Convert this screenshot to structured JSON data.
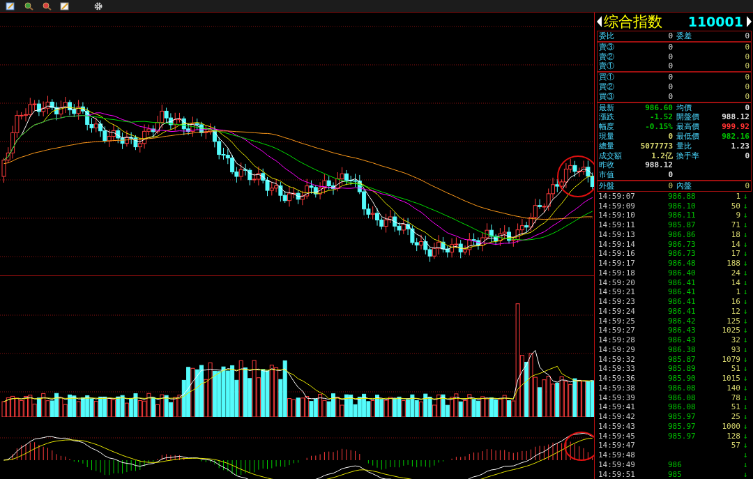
{
  "quote": {
    "name": "综合指数",
    "code": "110001"
  },
  "order_ratio": [
    {
      "label": "委比",
      "value": "0"
    },
    {
      "label": "委差",
      "value": "0"
    }
  ],
  "sell_levels": [
    {
      "label": "賣③",
      "price": "0",
      "volume": "0"
    },
    {
      "label": "賣②",
      "price": "0",
      "volume": "0"
    },
    {
      "label": "賣①",
      "price": "0",
      "volume": "0"
    }
  ],
  "buy_levels": [
    {
      "label": "買①",
      "price": "0",
      "volume": "0"
    },
    {
      "label": "買②",
      "price": "0",
      "volume": "0"
    },
    {
      "label": "買③",
      "price": "0",
      "volume": "0"
    }
  ],
  "stats": [
    {
      "left": {
        "label": "最新",
        "value": "986.60",
        "color": "#00c000"
      },
      "right": {
        "label": "均價",
        "value": "0",
        "color": "#e0e0e0"
      }
    },
    {
      "left": {
        "label": "漲跌",
        "value": "-1.52",
        "color": "#00c000"
      },
      "right": {
        "label": "開盤價",
        "value": "988.12",
        "color": "#e0e0e0"
      }
    },
    {
      "left": {
        "label": "幅度",
        "value": "-0.15%",
        "color": "#00c000"
      },
      "right": {
        "label": "最高價",
        "value": "999.92",
        "color": "#ff3232"
      }
    },
    {
      "left": {
        "label": "現量",
        "value": "0",
        "color": "#d8d870"
      },
      "right": {
        "label": "最低價",
        "value": "982.16",
        "color": "#00c000"
      }
    },
    {
      "left": {
        "label": "總量",
        "value": "5077773",
        "color": "#d8d870"
      },
      "right": {
        "label": "量比",
        "value": "1.23",
        "color": "#e0e0e0"
      }
    },
    {
      "left": {
        "label": "成交額",
        "value": "1.2亿",
        "color": "#d8d870"
      },
      "right": {
        "label": "換手率",
        "value": "0",
        "color": "#e0e0e0"
      }
    },
    {
      "left": {
        "label": "昨收",
        "value": "988.12",
        "color": "#e0e0e0"
      }
    },
    {
      "left": {
        "label": "市值",
        "value": "0",
        "color": "#e0e0e0"
      }
    }
  ],
  "volume_split": [
    {
      "label": "外盤",
      "value": "0"
    },
    {
      "label": "內盤",
      "value": "0"
    }
  ],
  "ticks": [
    {
      "time": "14:59:07",
      "price": "986.88",
      "volume": "1",
      "arrow": "↓"
    },
    {
      "time": "14:59:09",
      "price": "986.10",
      "volume": "50",
      "arrow": "↓"
    },
    {
      "time": "14:59:10",
      "price": "986.11",
      "volume": "9",
      "arrow": "↓"
    },
    {
      "time": "14:59:11",
      "price": "985.87",
      "volume": "71",
      "arrow": "↓"
    },
    {
      "time": "14:59:13",
      "price": "986.86",
      "volume": "18",
      "arrow": "↓"
    },
    {
      "time": "14:59:14",
      "price": "986.73",
      "volume": "14",
      "arrow": "↓"
    },
    {
      "time": "14:59:16",
      "price": "986.73",
      "volume": "17",
      "arrow": "↓"
    },
    {
      "time": "14:59:17",
      "price": "986.48",
      "volume": "188",
      "arrow": "↓"
    },
    {
      "time": "14:59:18",
      "price": "986.40",
      "volume": "24",
      "arrow": "↓"
    },
    {
      "time": "14:59:20",
      "price": "986.41",
      "volume": "14",
      "arrow": "↓"
    },
    {
      "time": "14:59:21",
      "price": "986.41",
      "volume": "1",
      "arrow": "↓"
    },
    {
      "time": "14:59:23",
      "price": "986.41",
      "volume": "16",
      "arrow": "↓"
    },
    {
      "time": "14:59:24",
      "price": "986.41",
      "volume": "12",
      "arrow": "↓"
    },
    {
      "time": "14:59:25",
      "price": "986.42",
      "volume": "125",
      "arrow": "↓"
    },
    {
      "time": "14:59:27",
      "price": "986.43",
      "volume": "1025",
      "arrow": "↓"
    },
    {
      "time": "14:59:28",
      "price": "986.43",
      "volume": "32",
      "arrow": "↓"
    },
    {
      "time": "14:59:29",
      "price": "986.38",
      "volume": "93",
      "arrow": "↓"
    },
    {
      "time": "14:59:32",
      "price": "985.87",
      "volume": "1079",
      "arrow": "↓"
    },
    {
      "time": "14:59:33",
      "price": "985.89",
      "volume": "51",
      "arrow": "↓"
    },
    {
      "time": "14:59:36",
      "price": "985.90",
      "volume": "1015",
      "arrow": "↓"
    },
    {
      "time": "14:59:38",
      "price": "986.08",
      "volume": "140",
      "arrow": "↓"
    },
    {
      "time": "14:59:39",
      "price": "986.08",
      "volume": "78",
      "arrow": "↓"
    },
    {
      "time": "14:59:41",
      "price": "986.08",
      "volume": "51",
      "arrow": "↓"
    },
    {
      "time": "14:59:42",
      "price": "985.97",
      "volume": "25",
      "arrow": "↓"
    },
    {
      "time": "14:59:43",
      "price": "985.97",
      "volume": "1000",
      "arrow": "↓"
    },
    {
      "time": "14:59:45",
      "price": "985.97",
      "volume": "128",
      "arrow": "↓"
    },
    {
      "time": "14:59:47",
      "volume": "57",
      "arrow": "↓"
    },
    {
      "time": "14:59:48",
      "arrow": "↓"
    },
    {
      "time": "14:59:49",
      "price": "986",
      "arrow": "↓"
    },
    {
      "time": "14:59:51",
      "price": "985",
      "arrow": "↓"
    }
  ]
}
